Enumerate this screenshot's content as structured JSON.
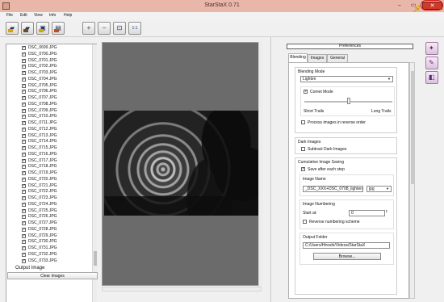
{
  "window": {
    "title": "StarStaX 0.71",
    "controls": {
      "minimize": "–",
      "maximize": "▭",
      "close": "✕"
    }
  },
  "menu": [
    "File",
    "Edit",
    "View",
    "Info",
    "Help"
  ],
  "toolbar": {
    "buttons": [
      {
        "name": "open-images-button",
        "glyph": "📂"
      },
      {
        "name": "open-dark-images-button",
        "glyph": "📁"
      },
      {
        "name": "save-image-button",
        "glyph": "💾"
      },
      {
        "name": "export-button",
        "glyph": "🖼"
      },
      {
        "name": "zoom-in-button",
        "glyph": "+"
      },
      {
        "name": "zoom-out-button",
        "glyph": "−"
      },
      {
        "name": "fit-window-button",
        "glyph": "⊡"
      },
      {
        "name": "actual-size-button",
        "glyph": "1:1"
      }
    ]
  },
  "file_list": {
    "items": [
      "DSC_0699.JPG",
      "DSC_0700.JPG",
      "DSC_0701.JPG",
      "DSC_0702.JPG",
      "DSC_0703.JPG",
      "DSC_0704.JPG",
      "DSC_0705.JPG",
      "DSC_0706.JPG",
      "DSC_0707.JPG",
      "DSC_0708.JPG",
      "DSC_0709.JPG",
      "DSC_0710.JPG",
      "DSC_0711.JPG",
      "DSC_0712.JPG",
      "DSC_0713.JPG",
      "DSC_0714.JPG",
      "DSC_0715.JPG",
      "DSC_0716.JPG",
      "DSC_0717.JPG",
      "DSC_0718.JPG",
      "DSC_0719.JPG",
      "DSC_0720.JPG",
      "DSC_0721.JPG",
      "DSC_0722.JPG",
      "DSC_0723.JPG",
      "DSC_0724.JPG",
      "DSC_0725.JPG",
      "DSC_0726.JPG",
      "DSC_0727.JPG",
      "DSC_0728.JPG",
      "DSC_0729.JPG",
      "DSC_0730.JPG",
      "DSC_0731.JPG",
      "DSC_0732.JPG",
      "DSC_0733.JPG"
    ],
    "output_label": "Output Image",
    "clear_button": "Clear Images"
  },
  "preferences": {
    "header": "Preferences",
    "tabs": [
      "Blending",
      "Images",
      "General"
    ],
    "active_tab": "Blending",
    "blending_mode": {
      "title": "Blending Mode",
      "selected": "Lighten",
      "comet_mode_label": "Comet Mode",
      "comet_mode_checked": true,
      "short_trails": "Short Trails",
      "long_trails": "Long Trails",
      "slider_value": 0.5,
      "reverse_order_label": "Process images in reverse order",
      "reverse_order_checked": false
    },
    "dark_images": {
      "title": "Dark Images",
      "subtract_label": "Subtract Dark Images",
      "subtract_checked": false
    },
    "cumulative": {
      "title": "Cumulative Image Saving",
      "save_after_each_label": "Save after each step",
      "save_after_each_checked": true,
      "image_name_title": "Image Name",
      "image_name_value": "_DSC_XXX+DSC_0708_lightenAll",
      "format": "jpg",
      "numbering_title": "Image Numbering",
      "start_at_label": "Start at:",
      "start_at_value": "0",
      "reverse_numbering_label": "Reverse numbering scheme",
      "reverse_numbering_checked": false,
      "output_folder_title": "Output Folder",
      "output_folder_value": "C:/Users/Hiroshi/Videos/StarStaX",
      "browse_button": "Browse..."
    }
  },
  "accent_colors": {
    "close": "#cc3b2b",
    "highlight": "#d21b1b",
    "hint_arrow": "#f6c21c"
  }
}
